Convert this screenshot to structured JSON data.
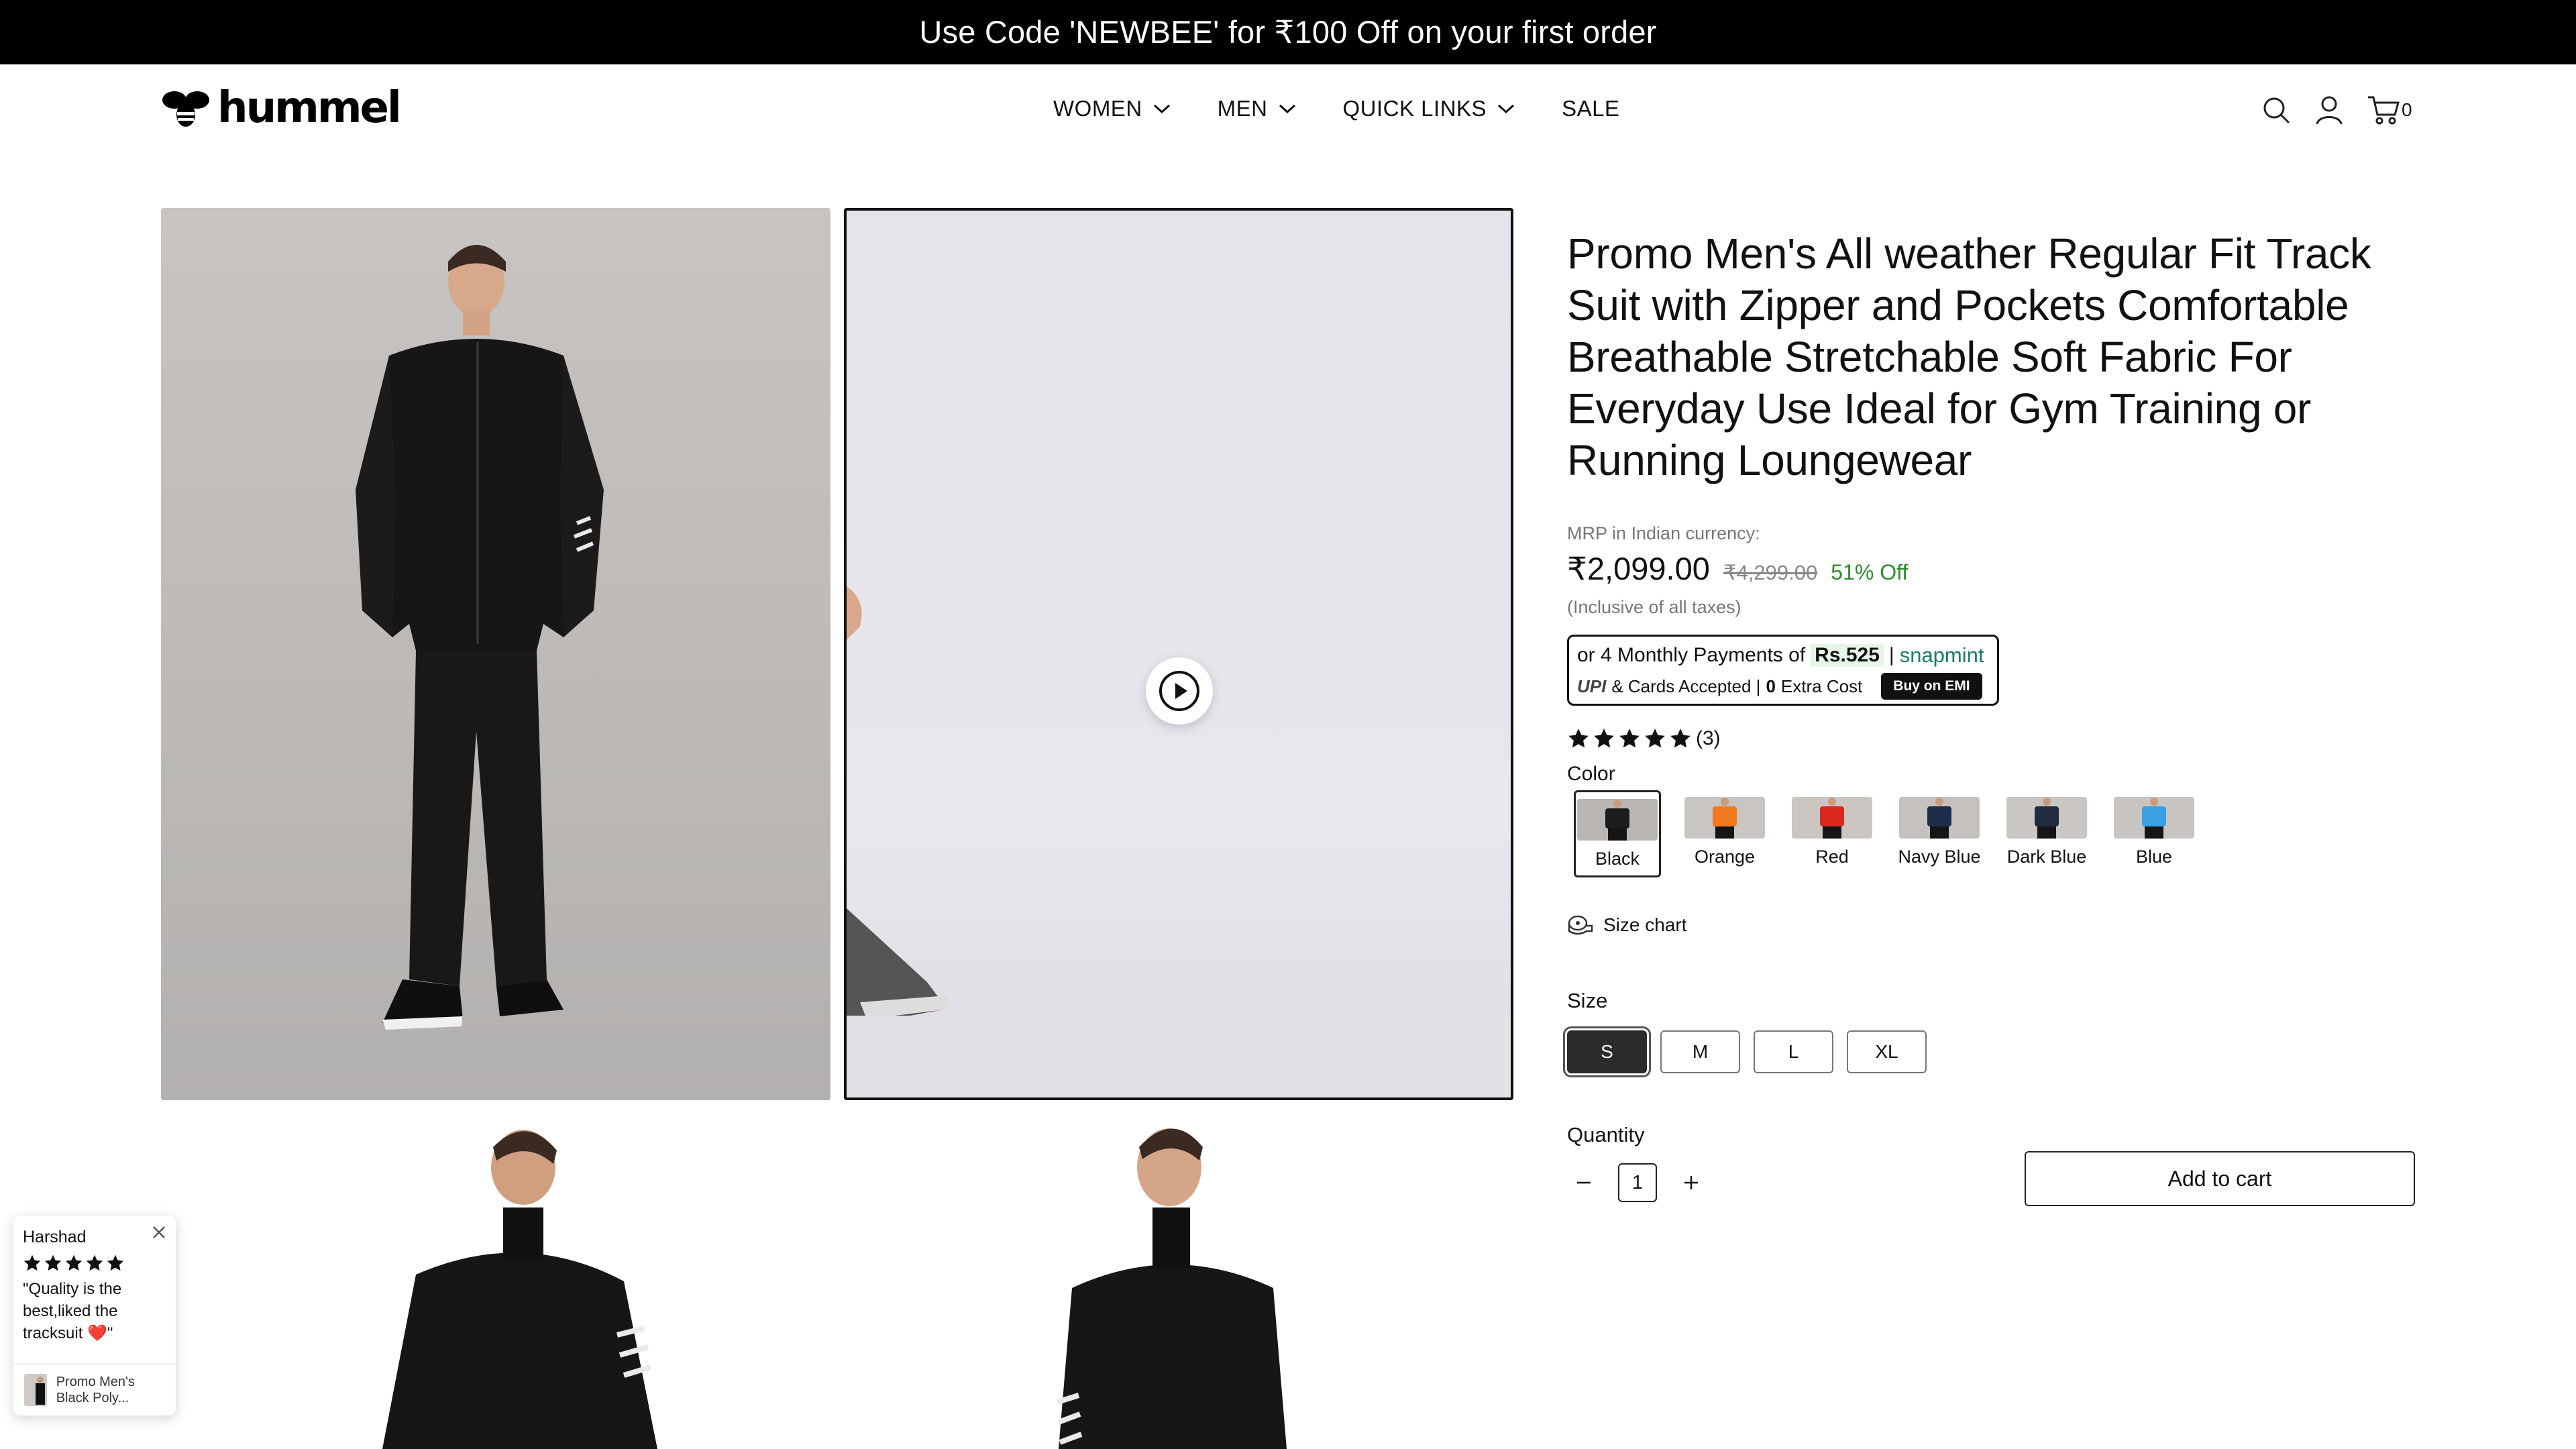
{
  "announcement": {
    "text": "Use Code 'NEWBEE' for ₹100 Off on your first order"
  },
  "header": {
    "logo_text": "hummel",
    "nav": [
      {
        "label": "WOMEN",
        "has_dropdown": true
      },
      {
        "label": "MEN",
        "has_dropdown": true
      },
      {
        "label": "QUICK LINKS",
        "has_dropdown": true
      },
      {
        "label": "SALE",
        "has_dropdown": false
      }
    ],
    "icons": [
      "search-icon",
      "account-icon",
      "cart-icon"
    ],
    "cart_count": "0"
  },
  "gallery": {
    "tiles": [
      "product-image-front",
      "product-video",
      "product-image-side",
      "product-image-closeup"
    ]
  },
  "product": {
    "title": "Promo Men's All weather Regular Fit Track Suit with Zipper and Pockets Comfortable Breathable Stretchable Soft Fabric For Everyday Use Ideal for Gym Training or Running Loungewear",
    "mrp_label": "MRP in Indian currency:",
    "price": "₹2,099.00",
    "compare_price": "₹4,299.00",
    "discount": "51% Off",
    "tax_note": "(Inclusive of all taxes)",
    "emi": {
      "line1_prefix": "or 4 Monthly Payments of",
      "amount": "Rs.525",
      "separator": "|",
      "brand": "snapmint",
      "upi": "UPI",
      "line2": "& Cards Accepted |",
      "extra_zero": "0",
      "extra_cost": "Extra Cost",
      "button": "Buy on EMI"
    },
    "rating": {
      "stars": 5,
      "count": "(3)"
    },
    "color_label": "Color",
    "colors": [
      {
        "name": "Black",
        "top": "#1c1c1c",
        "bg": "#b9b6b3",
        "selected": true
      },
      {
        "name": "Orange",
        "top": "#f07a1e",
        "bg": "#c9c5c2",
        "selected": false
      },
      {
        "name": "Red",
        "top": "#d8281f",
        "bg": "#cbc6c2",
        "selected": false
      },
      {
        "name": "Navy Blue",
        "top": "#1e2b4a",
        "bg": "#c4c1bf",
        "selected": false
      },
      {
        "name": "Dark Blue",
        "top": "#222a40",
        "bg": "#c9c6c4",
        "selected": false
      },
      {
        "name": "Blue",
        "top": "#3aa0e0",
        "bg": "#c8c4c1",
        "selected": false
      }
    ],
    "size_chart_label": "Size chart",
    "size_label": "Size",
    "sizes": [
      {
        "label": "S",
        "selected": true
      },
      {
        "label": "M",
        "selected": false
      },
      {
        "label": "L",
        "selected": false
      },
      {
        "label": "XL",
        "selected": false
      }
    ],
    "quantity_label": "Quantity",
    "quantity": "1",
    "add_to_cart": "Add to cart"
  },
  "review_popup": {
    "name": "Harshad",
    "stars": 5,
    "quote": "\"Quality is the best,liked the tracksuit ❤️\"",
    "product_title": "Promo Men's Black Poly..."
  },
  "colors": {
    "discount": "#2e8b2e",
    "accent": "#111111",
    "announcement_bg": "#000000"
  }
}
